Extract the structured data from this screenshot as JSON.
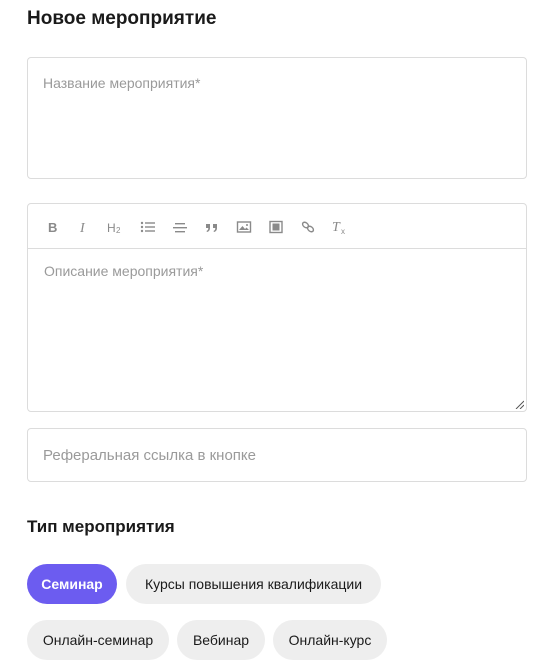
{
  "form": {
    "title": "Новое мероприятие",
    "name_field": {
      "placeholder": "Название мероприятия*",
      "value": ""
    },
    "description_field": {
      "placeholder": "Описание мероприятия*",
      "value": ""
    },
    "referral_field": {
      "placeholder": "Реферальная ссылка в кнопке",
      "value": ""
    }
  },
  "toolbar": {
    "buttons": [
      {
        "icon": "bold-icon",
        "glyph": "B"
      },
      {
        "icon": "italic-icon",
        "glyph": "I"
      },
      {
        "icon": "heading-icon",
        "glyph": "H2"
      },
      {
        "icon": "bullet-list-icon",
        "glyph": ""
      },
      {
        "icon": "horizontal-rule-icon",
        "glyph": ""
      },
      {
        "icon": "quote-icon",
        "glyph": "❞"
      },
      {
        "icon": "image-icon",
        "glyph": ""
      },
      {
        "icon": "video-icon",
        "glyph": ""
      },
      {
        "icon": "link-icon",
        "glyph": ""
      },
      {
        "icon": "clear-format-icon",
        "glyph": "Tx"
      }
    ]
  },
  "event_type": {
    "title": "Тип мероприятия",
    "options": [
      {
        "label": "Семинар",
        "selected": true
      },
      {
        "label": "Курсы повышения квалификации",
        "selected": false
      },
      {
        "label": "Онлайн-семинар",
        "selected": false
      },
      {
        "label": "Вебинар",
        "selected": false
      },
      {
        "label": "Онлайн-курс",
        "selected": false
      }
    ]
  },
  "colors": {
    "accent": "#6c5cf0",
    "chip_bg": "#eeeeee",
    "border": "#dcdcdc",
    "placeholder": "#9a9a9a"
  }
}
